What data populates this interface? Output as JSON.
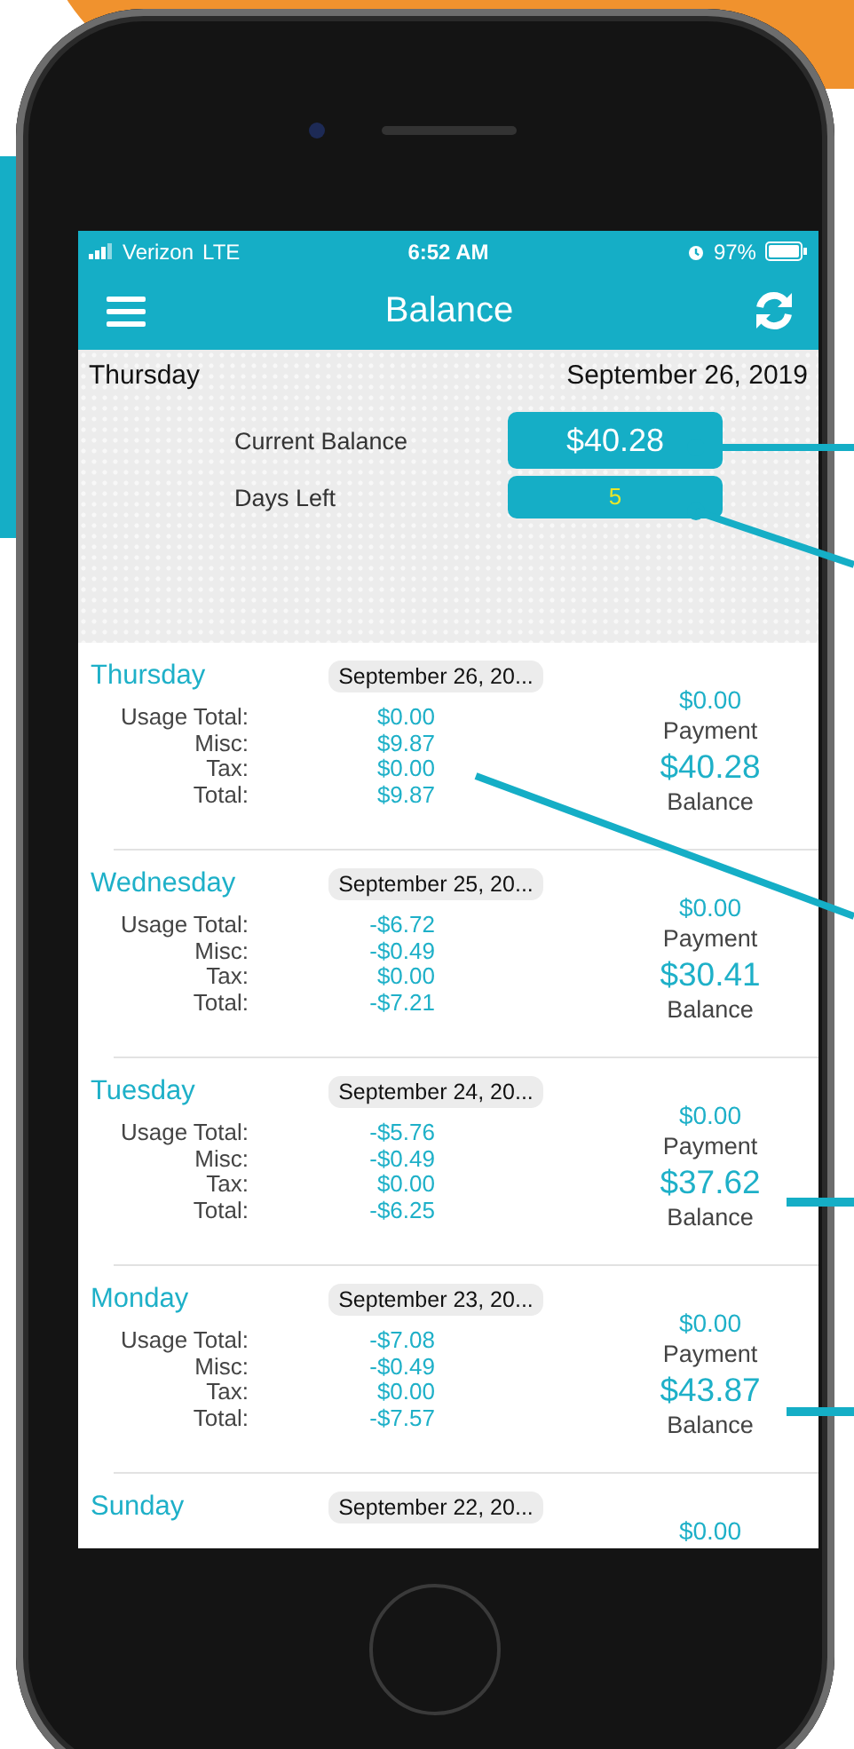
{
  "status_bar": {
    "carrier": "Verizon",
    "network": "LTE",
    "time": "6:52 AM",
    "battery": "97%"
  },
  "nav_bar": {
    "title": "Balance"
  },
  "summary": {
    "day": "Thursday",
    "date": "September 26, 2019",
    "current_balance_label": "Current Balance",
    "current_balance": "$40.28",
    "days_left_label": "Days Left",
    "days_left": "5"
  },
  "days": [
    {
      "day": "Thursday",
      "date": "September 26, 20...",
      "lines": [
        {
          "label": "Usage Total:",
          "value": "$0.00"
        },
        {
          "label": "Misc:",
          "value": "$9.87"
        },
        {
          "label": "Tax:",
          "value": "$0.00"
        },
        {
          "label": "Total:",
          "value": "$9.87"
        }
      ],
      "payment": "$0.00",
      "payment_label": "Payment",
      "balance": "$40.28",
      "balance_label": "Balance"
    },
    {
      "day": "Wednesday",
      "date": "September 25, 20...",
      "lines": [
        {
          "label": "Usage Total:",
          "value": "-$6.72"
        },
        {
          "label": "Misc:",
          "value": "-$0.49"
        },
        {
          "label": "Tax:",
          "value": "$0.00"
        },
        {
          "label": "Total:",
          "value": "-$7.21"
        }
      ],
      "payment": "$0.00",
      "payment_label": "Payment",
      "balance": "$30.41",
      "balance_label": "Balance"
    },
    {
      "day": "Tuesday",
      "date": "September 24, 20...",
      "lines": [
        {
          "label": "Usage Total:",
          "value": "-$5.76"
        },
        {
          "label": "Misc:",
          "value": "-$0.49"
        },
        {
          "label": "Tax:",
          "value": "$0.00"
        },
        {
          "label": "Total:",
          "value": "-$6.25"
        }
      ],
      "payment": "$0.00",
      "payment_label": "Payment",
      "balance": "$37.62",
      "balance_label": "Balance"
    },
    {
      "day": "Monday",
      "date": "September 23, 20...",
      "lines": [
        {
          "label": "Usage Total:",
          "value": "-$7.08"
        },
        {
          "label": "Misc:",
          "value": "-$0.49"
        },
        {
          "label": "Tax:",
          "value": "$0.00"
        },
        {
          "label": "Total:",
          "value": "-$7.57"
        }
      ],
      "payment": "$0.00",
      "payment_label": "Payment",
      "balance": "$43.87",
      "balance_label": "Balance"
    },
    {
      "day": "Sunday",
      "date": "September 22, 20...",
      "payment": "$0.00"
    }
  ]
}
